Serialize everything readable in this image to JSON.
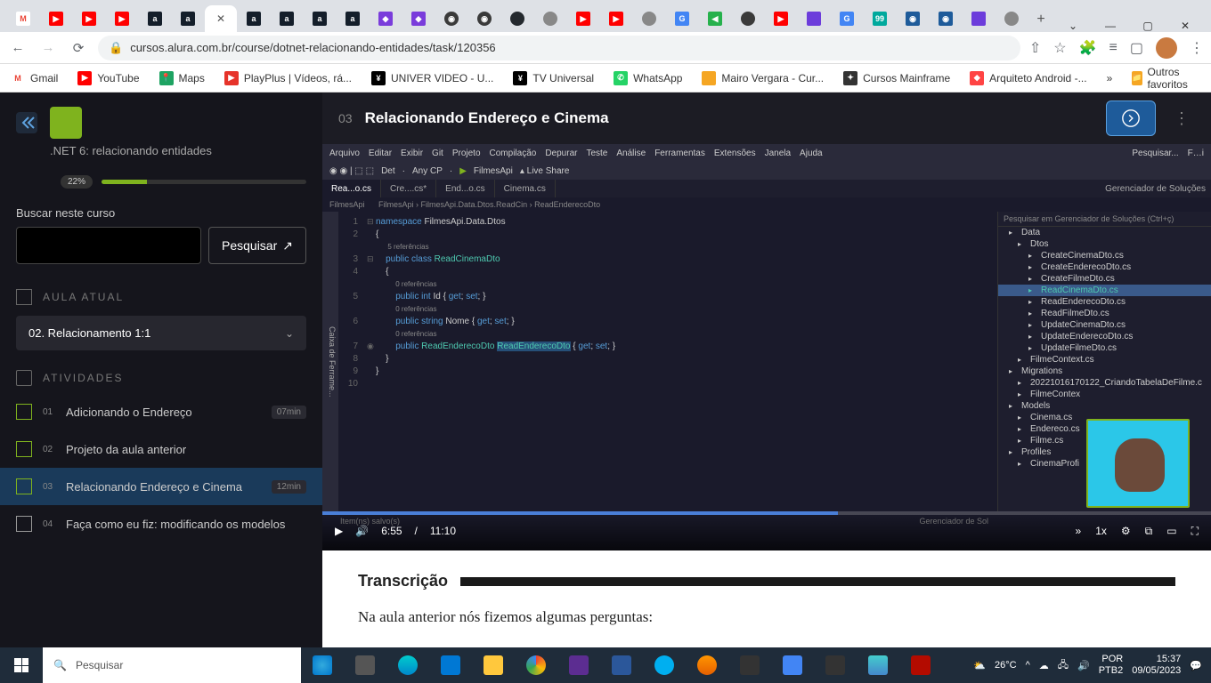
{
  "browser": {
    "url": "cursos.alura.com.br/course/dotnet-relacionando-entidades/task/120356",
    "window_controls": {
      "min": "—",
      "max": "▢",
      "close": "✕",
      "dropdown": "⌄"
    },
    "new_tab_label": "+",
    "bookmarks": [
      {
        "label": "Gmail"
      },
      {
        "label": "YouTube"
      },
      {
        "label": "Maps"
      },
      {
        "label": "PlayPlus | Vídeos, rá..."
      },
      {
        "label": "UNIVER VIDEO - U..."
      },
      {
        "label": "TV Universal"
      },
      {
        "label": "WhatsApp"
      },
      {
        "label": "Mairo Vergara - Cur..."
      },
      {
        "label": "Cursos Mainframe"
      },
      {
        "label": "Arquiteto Android -..."
      }
    ],
    "bookmarks_more": "»",
    "bookmarks_other": "Outros favoritos"
  },
  "sidebar": {
    "course_title": ".NET 6: relacionando entidades",
    "progress_pct": "22%",
    "search_label": "Buscar neste curso",
    "search_button": "Pesquisar",
    "section_current": "AULA ATUAL",
    "current_lesson": "02. Relacionamento 1:1",
    "section_activities": "ATIVIDADES",
    "activities": [
      {
        "num": "01",
        "label": "Adicionando o Endereço",
        "dur": "07min",
        "active": false
      },
      {
        "num": "02",
        "label": "Projeto da aula anterior",
        "dur": "",
        "active": false
      },
      {
        "num": "03",
        "label": "Relacionando Endereço e Cinema",
        "dur": "12min",
        "active": true
      },
      {
        "num": "04",
        "label": "Faça como eu fiz: modificando os modelos",
        "dur": "",
        "active": false
      }
    ]
  },
  "header": {
    "number": "03",
    "title": "Relacionando Endereço e Cinema"
  },
  "video": {
    "current": "6:55",
    "duration": "11:10",
    "speed": "1x",
    "vs_menu": [
      "Arquivo",
      "Editar",
      "Exibir",
      "Git",
      "Projeto",
      "Compilação",
      "Depurar",
      "Teste",
      "Análise",
      "Ferramentas",
      "Extensões",
      "Janela",
      "Ajuda"
    ],
    "vs_search": "Pesquisar...",
    "vs_live": "Live Share",
    "vs_project": "FilmesApi",
    "vs_config": "Det",
    "vs_platform": "Any CP",
    "vs_run": "FilmesApi",
    "tabs": [
      {
        "label": "Rea...o.cs",
        "active": true
      },
      {
        "label": "Cre....cs*",
        "active": false
      },
      {
        "label": "End...o.cs",
        "active": false
      },
      {
        "label": "Cinema.cs",
        "active": false
      }
    ],
    "breadcrumb": "FilmesApi  ›  FilmesApi.Data.Dtos.ReadCin  ›  ReadEnderecoDto",
    "sidebar_vert": "Caixa de Ferrame...",
    "solution_title": "Gerenciador de Soluções",
    "solution_search": "Pesquisar em Gerenciador de Soluções (Ctrl+ç)",
    "solution_tree": [
      {
        "label": "Data",
        "level": 1
      },
      {
        "label": "Dtos",
        "level": 2
      },
      {
        "label": "CreateCinemaDto.cs",
        "level": 3
      },
      {
        "label": "CreateEnderecoDto.cs",
        "level": 3
      },
      {
        "label": "CreateFilmeDto.cs",
        "level": 3
      },
      {
        "label": "ReadCinemaDto.cs",
        "level": 3,
        "sel": true
      },
      {
        "label": "ReadEnderecoDto.cs",
        "level": 3
      },
      {
        "label": "ReadFilmeDto.cs",
        "level": 3
      },
      {
        "label": "UpdateCinemaDto.cs",
        "level": 3
      },
      {
        "label": "UpdateEnderecoDto.cs",
        "level": 3
      },
      {
        "label": "UpdateFilmeDto.cs",
        "level": 3
      },
      {
        "label": "FilmeContext.cs",
        "level": 2
      },
      {
        "label": "Migrations",
        "level": 1
      },
      {
        "label": "20221016170122_CriandoTabelaDeFilme.c",
        "level": 2
      },
      {
        "label": "FilmeContex",
        "level": 2
      },
      {
        "label": "Models",
        "level": 1
      },
      {
        "label": "Cinema.cs",
        "level": 2
      },
      {
        "label": "Endereco.cs",
        "level": 2
      },
      {
        "label": "Filme.cs",
        "level": 2
      },
      {
        "label": "Profiles",
        "level": 1
      },
      {
        "label": "CinemaProfi",
        "level": 2
      }
    ],
    "status_bar": "Item(ns) salvo(s)",
    "lower_tab": "Gerenciador de Sol"
  },
  "code": {
    "ns": "namespace FilmesApi.Data.Dtos",
    "ref5": "5 referências",
    "class_decl_kw": "public class ",
    "class_name": "ReadCinemaDto",
    "ref0": "0 referências",
    "prop_id": "public int Id { get; set; }",
    "prop_nome": "public string Nome { get; set; }",
    "prop_end_kw": "public ",
    "prop_end_type": "ReadEnderecoDto ",
    "prop_end_name": "ReadEnderecoDto",
    "prop_end_rest": " { get; set; }"
  },
  "transcript": {
    "title": "Transcrição",
    "body": "Na aula anterior nós fizemos algumas perguntas:"
  },
  "taskbar": {
    "search_placeholder": "Pesquisar",
    "temp": "26°C",
    "lang1": "POR",
    "lang2": "PTB2",
    "time": "15:37",
    "date": "09/05/2023"
  }
}
